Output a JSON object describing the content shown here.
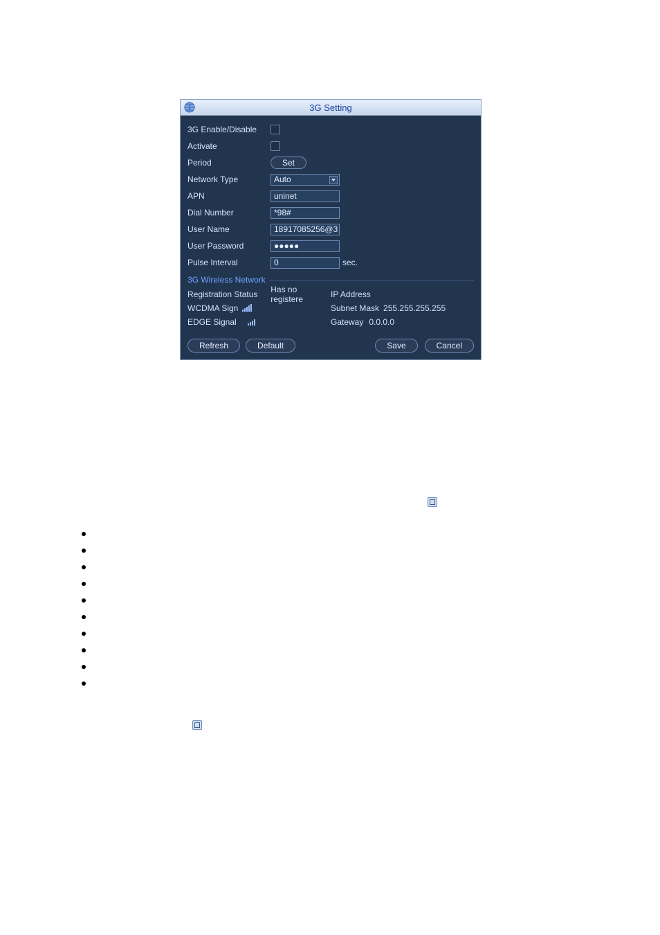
{
  "title": "3G Setting",
  "fields": {
    "enable_label": "3G Enable/Disable",
    "activate_label": "Activate",
    "period_label": "Period",
    "period_button": "Set",
    "network_type_label": "Network Type",
    "network_type_value": "Auto",
    "apn_label": "APN",
    "apn_value": "uninet",
    "dial_label": "Dial Number",
    "dial_value": "*98#",
    "user_label": "User Name",
    "user_value": "18917085256@3",
    "pass_label": "User Password",
    "pass_value": "●●●●●",
    "pulse_label": "Pulse Interval",
    "pulse_value": "0",
    "pulse_unit": "sec."
  },
  "section": "3G Wireless Network",
  "status": {
    "reg_label": "Registration Status",
    "reg_value": "Has no registere",
    "wcdma_label": "WCDMA Sign",
    "edge_label": "EDGE Signal",
    "ip_label": "IP Address",
    "subnet_label": "Subnet Mask",
    "subnet_value": "255.255.255.255",
    "gateway_label": "Gateway",
    "gateway_value": "0.0.0.0"
  },
  "buttons": {
    "refresh": "Refresh",
    "default": "Default",
    "save": "Save",
    "cancel": "Cancel"
  }
}
